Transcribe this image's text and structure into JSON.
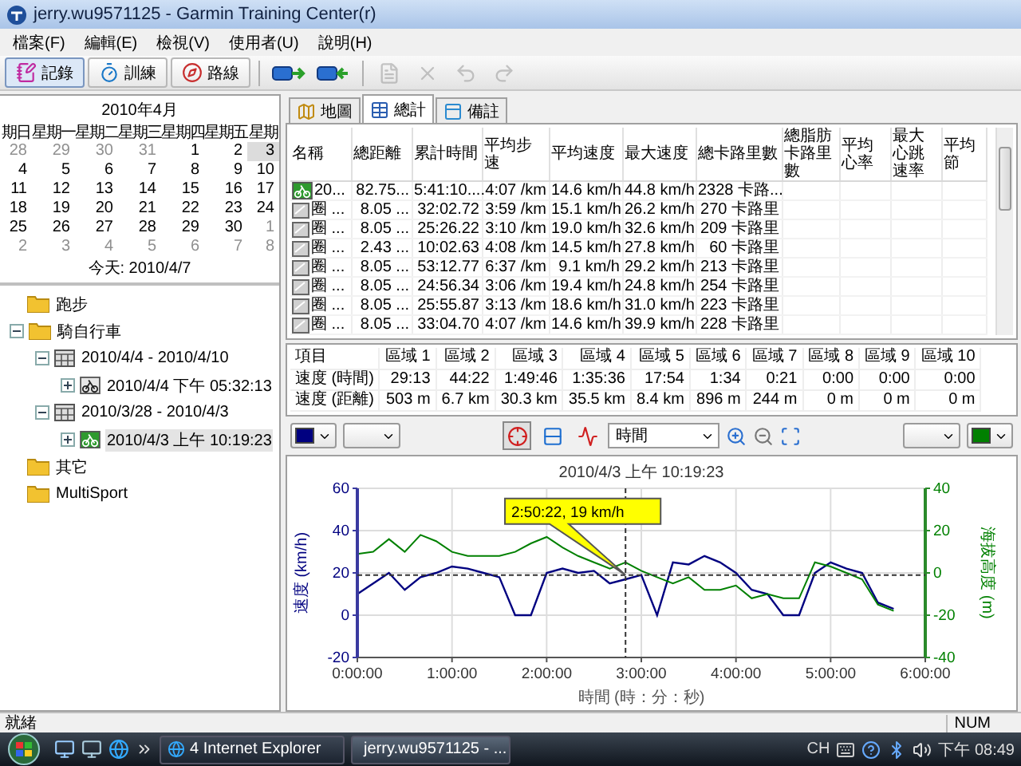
{
  "window": {
    "title": "jerry.wu9571125 - Garmin Training Center(r)"
  },
  "menu": [
    "檔案(F)",
    "編輯(E)",
    "檢視(V)",
    "使用者(U)",
    "說明(H)"
  ],
  "toolbar": {
    "modes": [
      {
        "label": "記錄",
        "kind": "log",
        "selected": true
      },
      {
        "label": "訓練",
        "kind": "train",
        "selected": false
      },
      {
        "label": "路線",
        "kind": "route",
        "selected": false
      }
    ],
    "actions": [
      {
        "kind": "receive",
        "disabled": false
      },
      {
        "kind": "send",
        "disabled": false
      },
      {
        "kind": "document",
        "disabled": true
      },
      {
        "kind": "delete",
        "disabled": true
      },
      {
        "kind": "undo",
        "disabled": true
      },
      {
        "kind": "redo",
        "disabled": true
      }
    ]
  },
  "calendar": {
    "month": "2010年4月",
    "weekdays": [
      "期日",
      "星期一",
      "星期二",
      "星期三",
      "星期四",
      "星期五",
      "星期"
    ],
    "days": [
      {
        "day": "28",
        "other_month": true,
        "selected": false
      },
      {
        "day": "29",
        "other_month": true,
        "selected": false
      },
      {
        "day": "30",
        "other_month": true,
        "selected": false
      },
      {
        "day": "31",
        "other_month": true,
        "selected": false
      },
      {
        "day": "1",
        "other_month": false,
        "selected": false
      },
      {
        "day": "2",
        "other_month": false,
        "selected": false
      },
      {
        "day": "3",
        "other_month": false,
        "selected": true
      },
      {
        "day": "4",
        "other_month": false,
        "selected": false
      },
      {
        "day": "5",
        "other_month": false,
        "selected": false
      },
      {
        "day": "6",
        "other_month": false,
        "selected": false
      },
      {
        "day": "7",
        "other_month": false,
        "selected": false
      },
      {
        "day": "8",
        "other_month": false,
        "selected": false
      },
      {
        "day": "9",
        "other_month": false,
        "selected": false
      },
      {
        "day": "10",
        "other_month": false,
        "selected": false
      },
      {
        "day": "11",
        "other_month": false,
        "selected": false
      },
      {
        "day": "12",
        "other_month": false,
        "selected": false
      },
      {
        "day": "13",
        "other_month": false,
        "selected": false
      },
      {
        "day": "14",
        "other_month": false,
        "selected": false
      },
      {
        "day": "15",
        "other_month": false,
        "selected": false
      },
      {
        "day": "16",
        "other_month": false,
        "selected": false
      },
      {
        "day": "17",
        "other_month": false,
        "selected": false
      },
      {
        "day": "18",
        "other_month": false,
        "selected": false
      },
      {
        "day": "19",
        "other_month": false,
        "selected": false
      },
      {
        "day": "20",
        "other_month": false,
        "selected": false
      },
      {
        "day": "21",
        "other_month": false,
        "selected": false
      },
      {
        "day": "22",
        "other_month": false,
        "selected": false
      },
      {
        "day": "23",
        "other_month": false,
        "selected": false
      },
      {
        "day": "24",
        "other_month": false,
        "selected": false
      },
      {
        "day": "25",
        "other_month": false,
        "selected": false
      },
      {
        "day": "26",
        "other_month": false,
        "selected": false
      },
      {
        "day": "27",
        "other_month": false,
        "selected": false
      },
      {
        "day": "28",
        "other_month": false,
        "selected": false
      },
      {
        "day": "29",
        "other_month": false,
        "selected": false
      },
      {
        "day": "30",
        "other_month": false,
        "selected": false
      },
      {
        "day": "1",
        "other_month": true,
        "selected": false
      },
      {
        "day": "2",
        "other_month": true,
        "selected": false
      },
      {
        "day": "3",
        "other_month": true,
        "selected": false
      },
      {
        "day": "4",
        "other_month": true,
        "selected": false
      },
      {
        "day": "5",
        "other_month": true,
        "selected": false
      },
      {
        "day": "6",
        "other_month": true,
        "selected": false
      },
      {
        "day": "7",
        "other_month": true,
        "selected": false
      },
      {
        "day": "8",
        "other_month": true,
        "selected": false
      }
    ],
    "today": "今天: 2010/4/7"
  },
  "tree": [
    {
      "label": "跑步",
      "kind": "folder",
      "selected": false
    },
    {
      "label": "騎自行車",
      "kind": "folder",
      "expanded": true,
      "selected": false,
      "children": [
        {
          "label": "2010/4/4 - 2010/4/10",
          "kind": "week",
          "expanded": true,
          "selected": false,
          "children": [
            {
              "label": "2010/4/4 下午 05:32:13",
              "kind": "activity",
              "expanded": false,
              "selected": false
            }
          ]
        },
        {
          "label": "2010/3/28 - 2010/4/3",
          "kind": "week",
          "expanded": true,
          "selected": false,
          "children": [
            {
              "label": "2010/4/3 上午 10:19:23",
              "kind": "activity",
              "expanded": false,
              "selected": true
            }
          ]
        }
      ]
    },
    {
      "label": "其它",
      "kind": "folder",
      "selected": false
    },
    {
      "label": "MultiSport",
      "kind": "folder",
      "selected": false
    }
  ],
  "tabs": [
    {
      "label": "地圖",
      "kind": "map",
      "selected": false
    },
    {
      "label": "總計",
      "kind": "table",
      "selected": true
    },
    {
      "label": "備註",
      "kind": "note",
      "selected": false
    }
  ],
  "activities": {
    "columns": [
      "名稱",
      "總距離",
      "累計時間",
      "平均步速",
      "平均速度",
      "最大速度",
      "總卡路里數",
      "總脂肪卡路里數",
      "平均心率",
      "最大心跳速率",
      "平均節"
    ],
    "rows": [
      {
        "kind": "activity",
        "cells": [
          "20...",
          "82.75...",
          "5:41:10....",
          "4:07 /km",
          "14.6 km/h",
          "44.8 km/h",
          "2328 卡路..."
        ]
      },
      {
        "kind": "lap",
        "cells": [
          "圈 ...",
          "8.05 ...",
          "32:02.72",
          "3:59 /km",
          "15.1 km/h",
          "26.2 km/h",
          "270 卡路里"
        ]
      },
      {
        "kind": "lap",
        "cells": [
          "圈 ...",
          "8.05 ...",
          "25:26.22",
          "3:10 /km",
          "19.0 km/h",
          "32.6 km/h",
          "209 卡路里"
        ]
      },
      {
        "kind": "lap",
        "cells": [
          "圈 ...",
          "2.43 ...",
          "10:02.63",
          "4:08 /km",
          "14.5 km/h",
          "27.8 km/h",
          "60 卡路里"
        ]
      },
      {
        "kind": "lap",
        "cells": [
          "圈 ...",
          "8.05 ...",
          "53:12.77",
          "6:37 /km",
          "9.1 km/h",
          "29.2 km/h",
          "213 卡路里"
        ]
      },
      {
        "kind": "lap",
        "cells": [
          "圈 ...",
          "8.05 ...",
          "24:56.34",
          "3:06 /km",
          "19.4 km/h",
          "24.8 km/h",
          "254 卡路里"
        ]
      },
      {
        "kind": "lap",
        "cells": [
          "圈 ...",
          "8.05 ...",
          "25:55.87",
          "3:13 /km",
          "18.6 km/h",
          "31.0 km/h",
          "223 卡路里"
        ]
      },
      {
        "kind": "lap",
        "cells": [
          "圈 ...",
          "8.05 ...",
          "33:04.70",
          "4:07 /km",
          "14.6 km/h",
          "39.9 km/h",
          "228 卡路里"
        ]
      }
    ]
  },
  "zones": {
    "columns": [
      "項目",
      "區域 1",
      "區域 2",
      "區域 3",
      "區域 4",
      "區域 5",
      "區域 6",
      "區域 7",
      "區域 8",
      "區域 9",
      "區域 10"
    ],
    "rows": [
      [
        "速度 (時間)",
        "29:13",
        "44:22",
        "1:49:46",
        "1:35:36",
        "17:54",
        "1:34",
        "0:21",
        "0:00",
        "0:00",
        "0:00"
      ],
      [
        "速度 (距離)",
        "503 m",
        "6.7 km",
        "30.3 km",
        "35.5 km",
        "8.4 km",
        "896 m",
        "244 m",
        "0 m",
        "0 m",
        "0 m"
      ]
    ]
  },
  "chart_controls": {
    "views": [
      {
        "kind": "crosshair",
        "selected": true
      },
      {
        "kind": "split",
        "selected": false
      },
      {
        "kind": "smooth",
        "selected": false
      }
    ],
    "x_axis": "時間"
  },
  "chart_data": {
    "type": "line",
    "title": "2010/4/3 上午 10:19:23",
    "xlabel": "時間 (時：分：秒)",
    "ylabel": "速度 (km/h)",
    "y2label": "海拔高度 (m)",
    "x": [
      0,
      10,
      20,
      30,
      40,
      50,
      60,
      70,
      80,
      90,
      100,
      110,
      120,
      130,
      140,
      150,
      160,
      170,
      180,
      190,
      200,
      210,
      220,
      230,
      240,
      250,
      260,
      270,
      280,
      290,
      300,
      310,
      320,
      330,
      340
    ],
    "series": [
      {
        "color": "#000080",
        "values": [
          10,
          15,
          20,
          12,
          18,
          20,
          23,
          22,
          20,
          18,
          0,
          0,
          20,
          22,
          20,
          21,
          15,
          17,
          19,
          0,
          25,
          24,
          28,
          25,
          20,
          12,
          10,
          0,
          0,
          20,
          25,
          22,
          20,
          6,
          3
        ]
      },
      {
        "color": "#008000",
        "axis": "y2",
        "values": [
          9,
          10,
          16,
          10,
          18,
          15,
          10,
          8,
          8,
          8,
          10,
          14,
          17,
          12,
          8,
          5,
          2,
          5,
          1,
          -2,
          -5,
          -2,
          -8,
          -8,
          -6,
          -12,
          -10,
          -12,
          -12,
          5,
          3,
          0,
          -3,
          -15,
          -18
        ]
      }
    ],
    "grid": true,
    "xlim": [
      0,
      360
    ],
    "ylim": [
      -20,
      60
    ],
    "y2lim": [
      -40,
      40
    ],
    "xticks": [
      {
        "value": 0,
        "label": "0:00:00"
      },
      {
        "value": 60,
        "label": "1:00:00"
      },
      {
        "value": 120,
        "label": "2:00:00"
      },
      {
        "value": 180,
        "label": "3:00:00"
      },
      {
        "value": 240,
        "label": "4:00:00"
      },
      {
        "value": 300,
        "label": "5:00:00"
      },
      {
        "value": 360,
        "label": "6:00:00"
      }
    ],
    "yticks": [
      -20,
      0,
      20,
      40,
      60
    ],
    "y2ticks": [
      -40,
      -20,
      0,
      20,
      40
    ],
    "ref_lines": [
      {
        "axis": "x",
        "value": 170
      },
      {
        "axis": "y",
        "value": 19
      }
    ],
    "annotations": [
      "2:50:22, 19 km/h"
    ]
  },
  "status_bar": {
    "text": "就緒",
    "indicator": "NUM"
  },
  "taskbar": {
    "tasks": [
      {
        "label": "4 Internet Explorer",
        "kind": "browser",
        "selected": false
      },
      {
        "label": "jerry.wu9571125 - ...",
        "kind": "app",
        "selected": true
      }
    ],
    "language": "CH",
    "clock": "下午 08:49"
  }
}
